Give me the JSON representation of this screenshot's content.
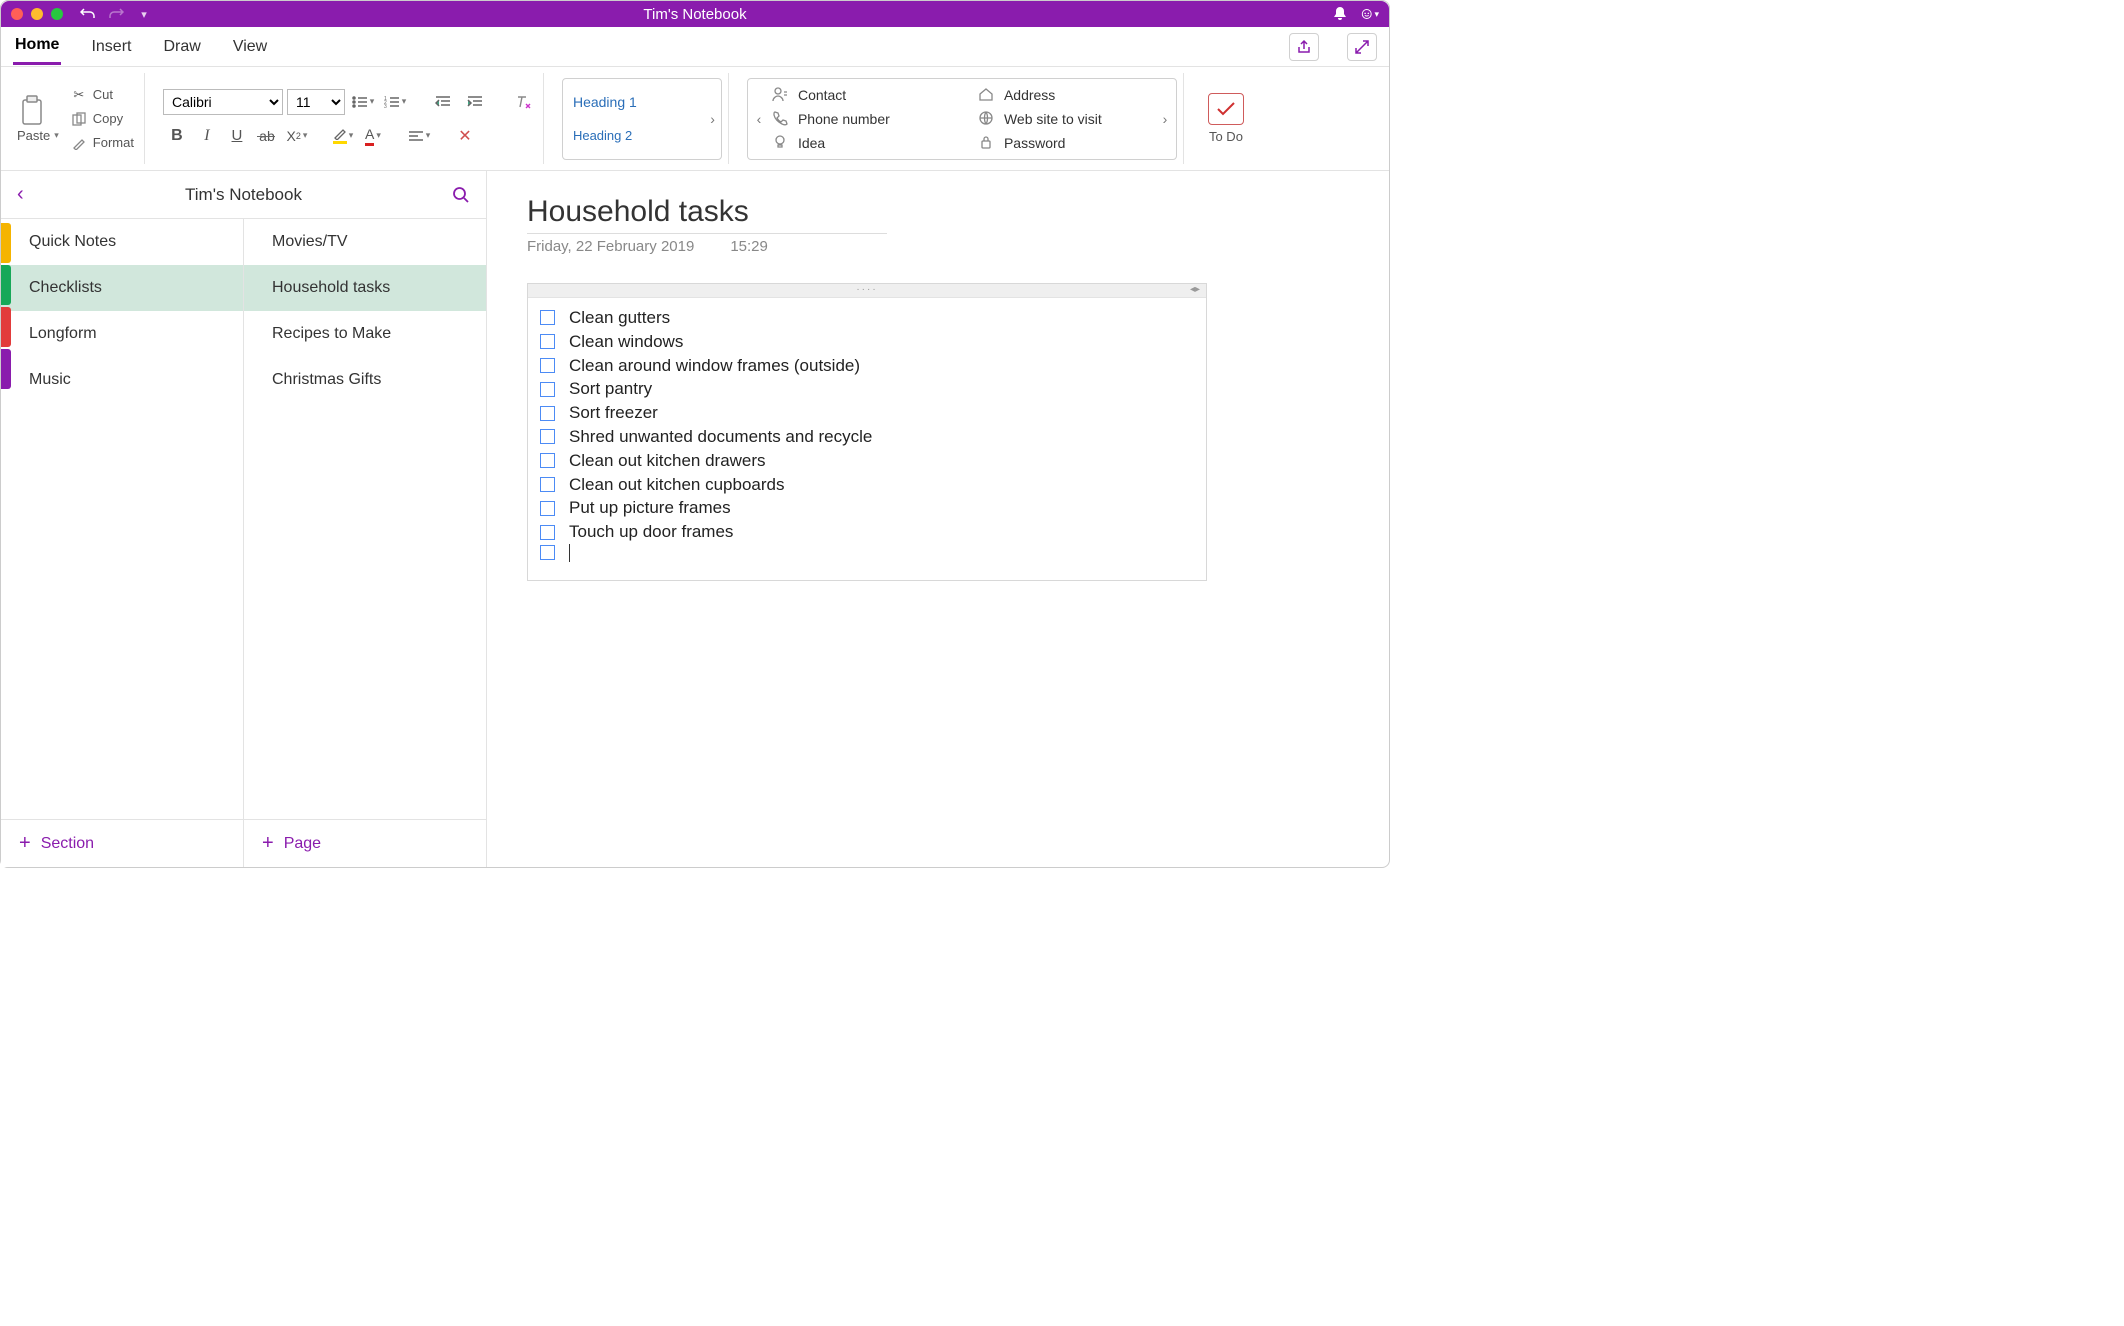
{
  "titlebar": {
    "title": "Tim's Notebook"
  },
  "tabs": {
    "items": [
      "Home",
      "Insert",
      "Draw",
      "View"
    ],
    "active": "Home"
  },
  "ribbon": {
    "paste_label": "Paste",
    "cut_label": "Cut",
    "copy_label": "Copy",
    "format_label": "Format",
    "font_name": "Calibri",
    "font_size": "11",
    "styles": {
      "heading1": "Heading 1",
      "heading2": "Heading 2"
    },
    "tags": {
      "col1": [
        "Contact",
        "Phone number",
        "Idea"
      ],
      "col2": [
        "Address",
        "Web site to visit",
        "Password"
      ]
    },
    "todo_label": "To Do"
  },
  "nav": {
    "title": "Tim's Notebook",
    "sections": [
      "Quick Notes",
      "Checklists",
      "Longform",
      "Music"
    ],
    "selected_section": "Checklists",
    "pages": [
      "Movies/TV",
      "Household tasks",
      "Recipes to Make",
      "Christmas Gifts"
    ],
    "selected_page": "Household tasks",
    "add_section_label": "Section",
    "add_page_label": "Page"
  },
  "page": {
    "title": "Household tasks",
    "date": "Friday, 22 February 2019",
    "time": "15:29",
    "checklist": [
      "Clean gutters",
      "Clean windows",
      "Clean around window frames (outside)",
      "Sort pantry",
      "Sort freezer",
      "Shred unwanted documents and recycle",
      "Clean out kitchen drawers",
      "Clean out kitchen cupboards",
      "Put up picture frames",
      "Touch up door frames"
    ]
  }
}
